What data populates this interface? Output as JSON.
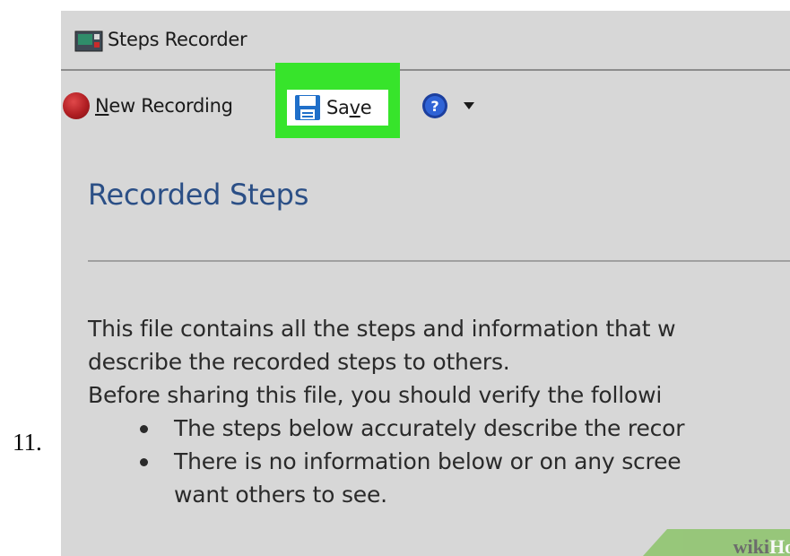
{
  "step_number": "11.",
  "window": {
    "title": "Steps Recorder"
  },
  "toolbar": {
    "new_recording": {
      "mnemonic": "N",
      "rest": "ew Recording"
    },
    "save": {
      "before": "Sa",
      "mnemonic": "v",
      "after": "e"
    },
    "help_icon": "help-question-icon",
    "dropdown_icon": "chevron-down-icon",
    "highlight_color": "#37e42b"
  },
  "content": {
    "section_title": "Recorded Steps",
    "paragraph_1a": "This file contains all the steps and information that w",
    "paragraph_1b": "describe the recorded steps to others.",
    "paragraph_2": "Before sharing this file, you should verify the followi",
    "bullets": [
      {
        "line1": "The steps below accurately describe the recor",
        "line2": ""
      },
      {
        "line1": "There is no information below or on any scree",
        "line2": "want others to see."
      }
    ]
  },
  "watermark": {
    "part1": "wiki",
    "part2": "How"
  }
}
